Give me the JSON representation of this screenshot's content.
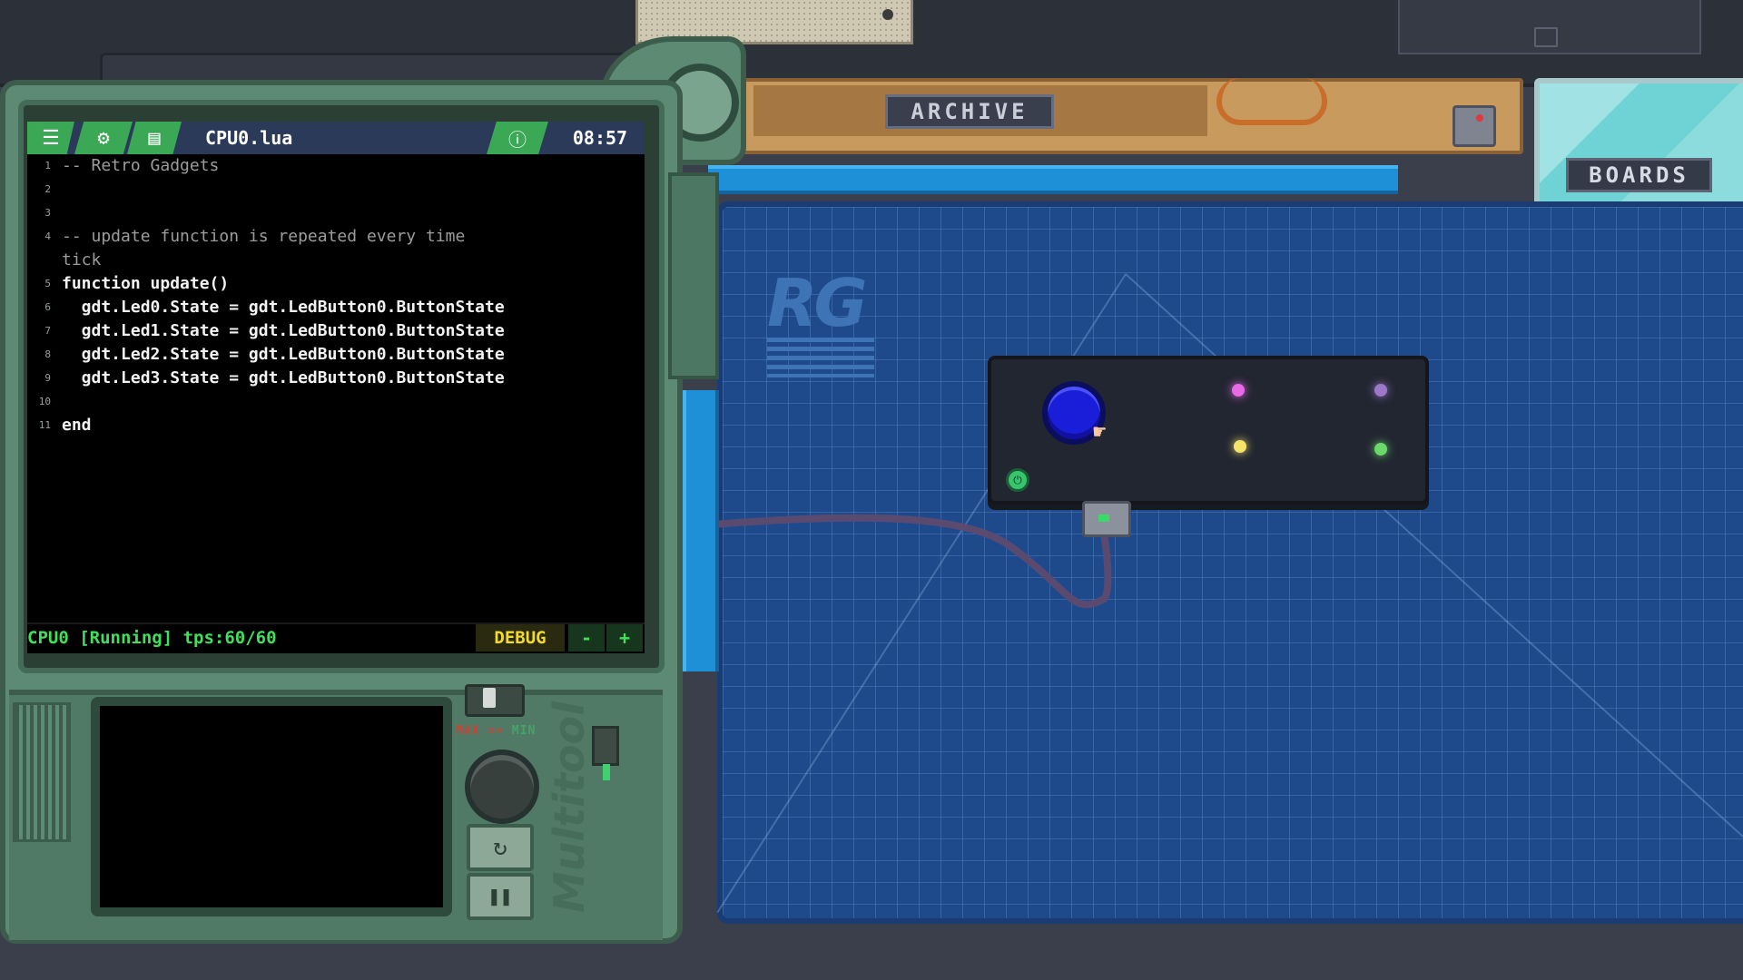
{
  "window": {
    "filename": "CPU0.lua",
    "clock": "08:57",
    "toolbar": {
      "menu_icon": "menu-icon",
      "gadget_icon": "gadget-icon",
      "file_icon": "file-icon",
      "info_icon": "info-icon"
    }
  },
  "code": {
    "lines": [
      {
        "n": "1",
        "text": "-- Retro Gadgets",
        "type": "comment"
      },
      {
        "n": "2",
        "text": "",
        "type": "code"
      },
      {
        "n": "3",
        "text": "",
        "type": "code"
      },
      {
        "n": "4",
        "text": "-- update function is repeated every time",
        "type": "comment"
      },
      {
        "n": "",
        "text": "tick",
        "type": "comment"
      },
      {
        "n": "5",
        "text": "function update()",
        "type": "code"
      },
      {
        "n": "6",
        "text": "  gdt.Led0.State = gdt.LedButton0.ButtonState",
        "type": "code"
      },
      {
        "n": "7",
        "text": "  gdt.Led1.State = gdt.LedButton0.ButtonState",
        "type": "code"
      },
      {
        "n": "8",
        "text": "  gdt.Led2.State = gdt.LedButton0.ButtonState",
        "type": "code"
      },
      {
        "n": "9",
        "text": "  gdt.Led3.State = gdt.LedButton0.ButtonState",
        "type": "code"
      },
      {
        "n": "10",
        "text": "",
        "type": "code"
      },
      {
        "n": "11",
        "text": "end",
        "type": "code"
      }
    ]
  },
  "status": {
    "text": "CPU0 [Running] tps:60/60",
    "debug_label": "DEBUG",
    "minus_label": "-",
    "plus_label": "+"
  },
  "multitool": {
    "max_label": "MAX",
    "min_label": "MIN",
    "brand": "Multitool"
  },
  "shelves": {
    "archive_label": "ARCHIVE",
    "boards_label": "BOARDS"
  },
  "mat": {
    "logo": "RG"
  },
  "gadget": {
    "led_colors": [
      "#e86ae6",
      "#9d77c8",
      "#f4e26a",
      "#6ad86b"
    ],
    "button_color": "#1a1ed8"
  }
}
